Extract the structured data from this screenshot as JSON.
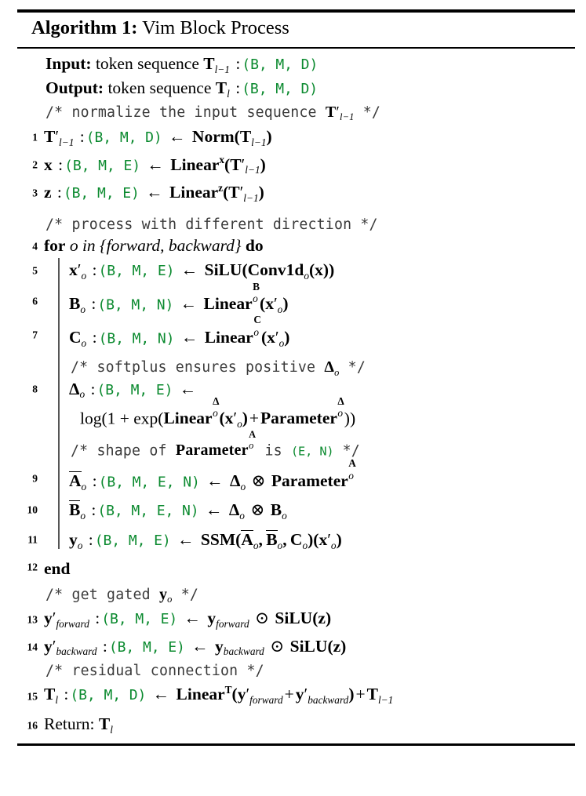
{
  "caption": {
    "label": "Algorithm 1:",
    "title": "Vim Block Process"
  },
  "shape_tokens": {
    "bmd": "(B, M, D)",
    "bme": "(B, M, E)",
    "bmn": "(B, M, N)",
    "bmen": "(B, M, E, N)",
    "en": "(E, N)"
  },
  "io": {
    "input_label": "Input:",
    "input_text": "token sequence",
    "input_var": "T",
    "input_var_sub": "l−1",
    "input_colon": ":",
    "input_shape": "(B, M, D)",
    "output_label": "Output:",
    "output_text": "token sequence",
    "output_var": "T",
    "output_var_sub": "l",
    "output_colon": ":",
    "output_shape": "(B, M, D)"
  },
  "comments": {
    "c1_pre": "/* normalize the input sequence",
    "c1_math": "T",
    "c1_math_sub": "l−1",
    "c1_post": "*/",
    "c2": "/* process with different direction */",
    "c3_pre": "/* softplus ensures positive",
    "c3_math": "Δ",
    "c3_math_sub": "o",
    "c3_post": "*/",
    "c4_pre": "/* shape of",
    "c4_math": "Parameter",
    "c4_math_sup": "A",
    "c4_math_sub": "o",
    "c4_mid": "is",
    "c4_shape": "(E, N)",
    "c4_post": "*/",
    "c5_pre": "/* get gated",
    "c5_math": "y",
    "c5_math_sub": "o",
    "c5_post": "*/",
    "c6": "/* residual connection */"
  },
  "lines": [
    {
      "num": "1",
      "lhs": "T",
      "lhs_prime": "′",
      "lhs_sub": "l−1",
      "shape": "(B, M, D)",
      "rhs_fn": "Norm",
      "rhs_arg": "T",
      "rhs_arg_sub": "l−1"
    },
    {
      "num": "2",
      "lhs": "x",
      "shape": "(B, M, E)",
      "rhs_fn": "Linear",
      "rhs_sup": "x",
      "rhs_arg": "T",
      "rhs_arg_prime": "′",
      "rhs_arg_sub": "l−1"
    },
    {
      "num": "3",
      "lhs": "z",
      "shape": "(B, M, E)",
      "rhs_fn": "Linear",
      "rhs_sup": "z",
      "rhs_arg": "T",
      "rhs_arg_prime": "′",
      "rhs_arg_sub": "l−1"
    },
    {
      "num": "4",
      "kw_for": "for",
      "loop_var": "o in {forward, backward}",
      "kw_do": "do"
    },
    {
      "num": "5",
      "lhs": "x",
      "lhs_prime": "′",
      "lhs_sub": "o",
      "shape": "(B, M, E)",
      "rhs_fn": "SiLU",
      "rhs_inner": "Conv1d",
      "rhs_inner_sub": "o",
      "rhs_arg": "x"
    },
    {
      "num": "6",
      "lhs": "B",
      "lhs_sub": "o",
      "shape": "(B, M, N)",
      "rhs_fn": "Linear",
      "rhs_sup": "B",
      "rhs_sub": "o",
      "rhs_arg": "x",
      "rhs_arg_prime": "′",
      "rhs_arg_sub": "o"
    },
    {
      "num": "7",
      "lhs": "C",
      "lhs_sub": "o",
      "shape": "(B, M, N)",
      "rhs_fn": "Linear",
      "rhs_sup": "C",
      "rhs_sub": "o",
      "rhs_arg": "x",
      "rhs_arg_prime": "′",
      "rhs_arg_sub": "o"
    },
    {
      "num": "8",
      "lhs": "Δ",
      "lhs_sub": "o",
      "shape": "(B, M, E)",
      "cont_pre": "log(1 + exp(",
      "cont_fn1": "Linear",
      "cont_fn1_sup": "Δ",
      "cont_fn1_sub": "o",
      "cont_arg": "x",
      "cont_arg_prime": "′",
      "cont_arg_sub": "o",
      "cont_plus": "+",
      "cont_fn2": "Parameter",
      "cont_fn2_sup": "Δ",
      "cont_fn2_sub": "o",
      "cont_post": "))"
    },
    {
      "num": "9",
      "lhs": "A",
      "lhs_sub": "o",
      "lhs_overline": true,
      "shape": "(B, M, E, N)",
      "rhs_a": "Δ",
      "rhs_a_sub": "o",
      "rhs_op": "⊗",
      "rhs_b": "Parameter",
      "rhs_b_sup": "A",
      "rhs_b_sub": "o"
    },
    {
      "num": "10",
      "lhs": "B",
      "lhs_sub": "o",
      "lhs_overline": true,
      "shape": "(B, M, E, N)",
      "rhs_a": "Δ",
      "rhs_a_sub": "o",
      "rhs_op": "⊗",
      "rhs_b": "B",
      "rhs_b_sub": "o"
    },
    {
      "num": "11",
      "lhs": "y",
      "lhs_sub": "o",
      "shape": "(B, M, E)",
      "rhs_fn": "SSM",
      "rhs_args": "Ā, B̄, C",
      "rhs_arg2": "x",
      "rhs_arg2_prime": "′",
      "rhs_arg2_sub": "o"
    },
    {
      "num": "12",
      "kw_end": "end"
    },
    {
      "num": "13",
      "lhs": "y",
      "lhs_prime": "′",
      "lhs_sub": "forward",
      "shape": "(B, M, E)",
      "rhs_a": "y",
      "rhs_a_sub": "forward",
      "rhs_op": "⊙",
      "rhs_fn": "SiLU",
      "rhs_arg": "z"
    },
    {
      "num": "14",
      "lhs": "y",
      "lhs_prime": "′",
      "lhs_sub": "backward",
      "shape": "(B, M, E)",
      "rhs_a": "y",
      "rhs_a_sub": "backward",
      "rhs_op": "⊙",
      "rhs_fn": "SiLU",
      "rhs_arg": "z"
    },
    {
      "num": "15",
      "lhs": "T",
      "lhs_sub": "l",
      "shape": "(B, M, D)",
      "rhs_fn": "Linear",
      "rhs_sup": "T",
      "rhs_a": "y",
      "rhs_a_prime": "′",
      "rhs_a_sub": "forward",
      "rhs_plus": "+",
      "rhs_b": "y",
      "rhs_b_prime": "′",
      "rhs_b_sub": "backward",
      "rhs_tail_plus": "+",
      "rhs_tail": "T",
      "rhs_tail_sub": "l−1"
    },
    {
      "num": "16",
      "kw_return": "Return:",
      "ret_var": "T",
      "ret_var_sub": "l"
    }
  ],
  "symbols": {
    "arrow_left": "←",
    "colon": ":",
    "otimes": "⊗",
    "odot": "⊙",
    "prime": "′",
    "lparen": "(",
    "rparen": ")"
  },
  "colors": {
    "shape_green": "#0b8a2f",
    "comment_gray": "#3a3a3a",
    "text_black": "#000000",
    "rule_black": "#000000",
    "loopbar_gray": "#555555"
  }
}
